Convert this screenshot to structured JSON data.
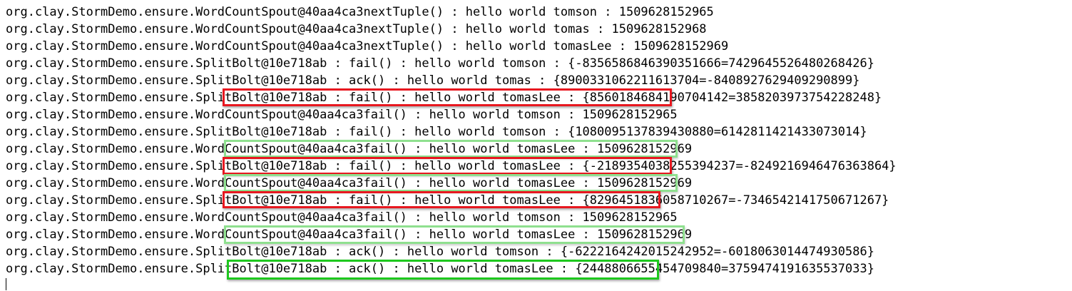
{
  "console": {
    "lines": [
      "org.clay.StormDemo.ensure.WordCountSpout@40aa4ca3nextTuple() : hello world tomson : 1509628152965",
      "org.clay.StormDemo.ensure.WordCountSpout@40aa4ca3nextTuple() : hello world tomas : 1509628152968",
      "org.clay.StormDemo.ensure.WordCountSpout@40aa4ca3nextTuple() : hello world tomasLee : 1509628152969",
      "org.clay.StormDemo.ensure.SplitBolt@10e718ab : fail() : hello world tomson : {-8356586846390351666=7429645526480268426}",
      "org.clay.StormDemo.ensure.SplitBolt@10e718ab : ack() : hello world tomas : {8900331062211613704=-8408927629409290899}",
      "org.clay.StormDemo.ensure.SplitBolt@10e718ab : fail() : hello world tomasLee : {8560184684190704142=3858203973754228248}",
      "org.clay.StormDemo.ensure.WordCountSpout@40aa4ca3fail() : hello world tomson : 1509628152965",
      "org.clay.StormDemo.ensure.SplitBolt@10e718ab : fail() : hello world tomson : {1080095137839430880=6142811421433073014}",
      "org.clay.StormDemo.ensure.WordCountSpout@40aa4ca3fail() : hello world tomasLee : 1509628152969",
      "org.clay.StormDemo.ensure.SplitBolt@10e718ab : fail() : hello world tomasLee : {-2189354038255394237=-8249216946476363864}",
      "org.clay.StormDemo.ensure.WordCountSpout@40aa4ca3fail() : hello world tomasLee : 1509628152969",
      "org.clay.StormDemo.ensure.SplitBolt@10e718ab : fail() : hello world tomasLee : {8296451836058710267=-7346542141750671267}",
      "org.clay.StormDemo.ensure.WordCountSpout@40aa4ca3fail() : hello world tomson : 1509628152965",
      "org.clay.StormDemo.ensure.WordCountSpout@40aa4ca3fail() : hello world tomasLee : 1509628152969",
      "org.clay.StormDemo.ensure.SplitBolt@10e718ab : ack() : hello world tomson : {-6222164242015242952=-6018063014474930586}",
      "org.clay.StormDemo.ensure.SplitBolt@10e718ab : ack() : hello world tomasLee : {2448806655454709840=3759474191635537033}"
    ],
    "highlight_colors": {
      "red": "#e8171f",
      "green": "#1ec81e",
      "light_green": "#8fe08f"
    }
  }
}
